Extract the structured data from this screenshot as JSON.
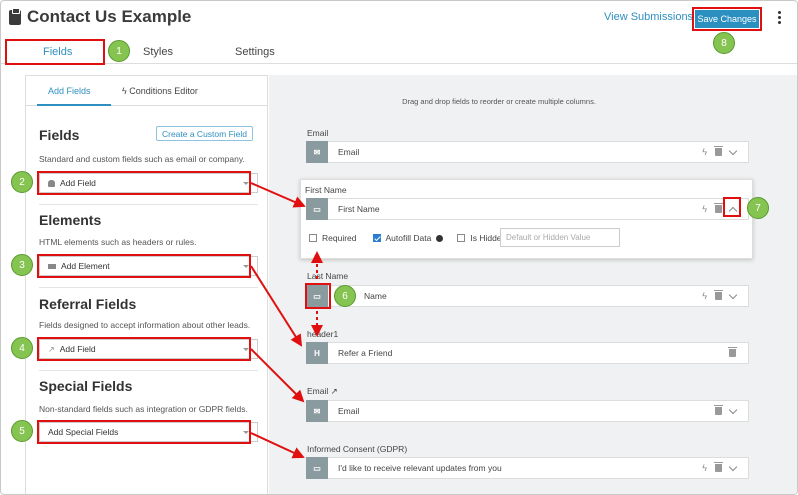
{
  "header": {
    "title": "Contact Us Example",
    "view_submissions": "View Submissions",
    "save_changes": "Save Changes"
  },
  "tabs": [
    "Fields",
    "Styles",
    "Settings"
  ],
  "left_panel": {
    "subtabs": [
      "Add Fields",
      "Conditions Editor"
    ],
    "create_custom": "Create a Custom Field",
    "sections": [
      {
        "heading": "Fields",
        "desc": "Standard and custom fields such as email or company.",
        "dropdown": "Add Field"
      },
      {
        "heading": "Elements",
        "desc": "HTML elements such as headers or rules.",
        "dropdown": "Add Element"
      },
      {
        "heading": "Referral Fields",
        "desc": "Fields designed to accept information about other leads.",
        "dropdown": "Add Field"
      },
      {
        "heading": "Special Fields",
        "desc": "Non-standard fields such as integration or GDPR fields.",
        "dropdown": "Add Special Fields"
      }
    ]
  },
  "canvas": {
    "hint": "Drag and drop fields to reorder or create multiple columns.",
    "fields": [
      {
        "label": "Email",
        "value": "Email"
      },
      {
        "label": "First Name",
        "value": "First Name"
      },
      {
        "label": "Last Name",
        "value": "Name"
      },
      {
        "label": "header1",
        "value": "Refer a Friend",
        "icon_text": "H"
      },
      {
        "label": "Email",
        "value": "Email"
      },
      {
        "label": "Informed Consent (GDPR)",
        "value": "I'd like to receive relevant updates from you"
      }
    ],
    "options": {
      "required": "Required",
      "autofill": "Autofill Data",
      "is_hidden": "Is Hidden?",
      "hidden_placeholder": "Default or Hidden Value"
    }
  },
  "callouts": [
    "1",
    "2",
    "3",
    "4",
    "5",
    "6",
    "7",
    "8"
  ],
  "colors": {
    "accent": "#2f8fc1",
    "callout": "#86c451",
    "highlight": "#e01010"
  }
}
